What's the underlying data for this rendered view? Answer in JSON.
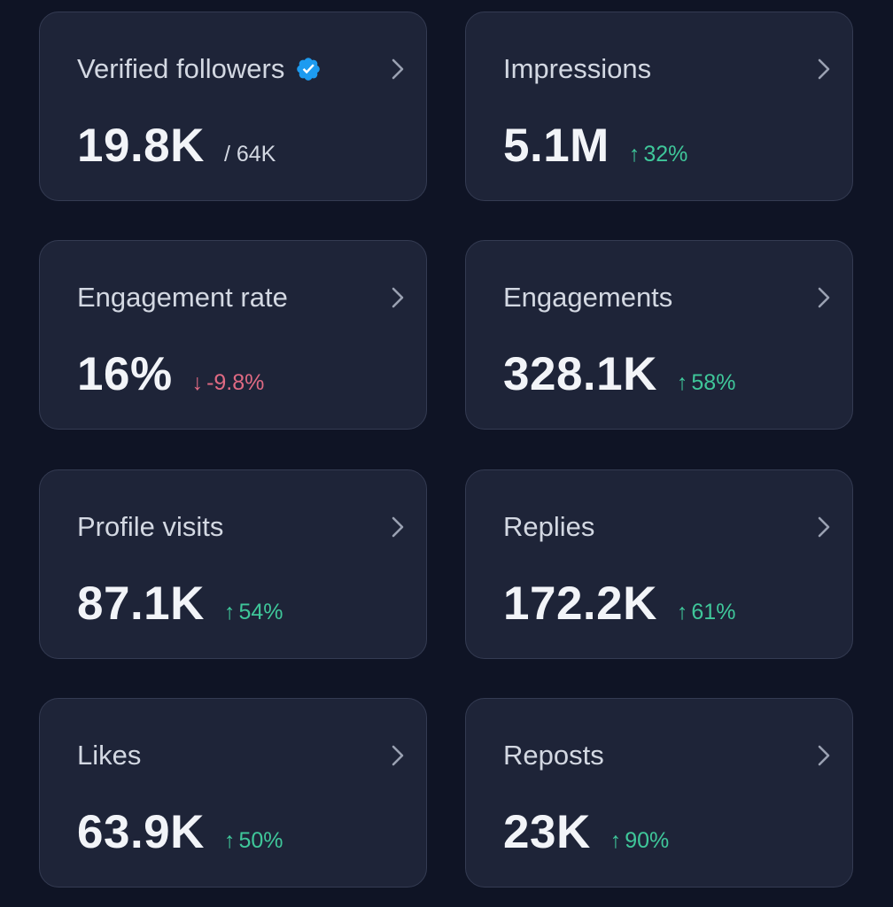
{
  "stats": {
    "verified_followers": {
      "title": "Verified followers",
      "value": "19.8K",
      "total": "/ 64K",
      "badge_icon": "verified-badge-icon",
      "badge_color": "#1d9bf0"
    },
    "impressions": {
      "title": "Impressions",
      "value": "5.1M",
      "arrow": "↑",
      "delta": "32%"
    },
    "engagement_rate": {
      "title": "Engagement rate",
      "value": "16%",
      "arrow": "↓",
      "delta": "-9.8%"
    },
    "engagements": {
      "title": "Engagements",
      "value": "328.1K",
      "arrow": "↑",
      "delta": "58%"
    },
    "profile_visits": {
      "title": "Profile visits",
      "value": "87.1K",
      "arrow": "↑",
      "delta": "54%"
    },
    "replies": {
      "title": "Replies",
      "value": "172.2K",
      "arrow": "↑",
      "delta": "61%"
    },
    "likes": {
      "title": "Likes",
      "value": "63.9K",
      "arrow": "↑",
      "delta": "50%"
    },
    "reposts": {
      "title": "Reposts",
      "value": "23K",
      "arrow": "↑",
      "delta": "90%"
    }
  },
  "colors": {
    "background": "#0f1425",
    "card": "#1e2438",
    "positive": "#3fc79a",
    "negative": "#e06a83"
  },
  "icons": {
    "chevron": "chevron-right-icon",
    "up": "arrow-up-icon",
    "down": "arrow-down-icon"
  }
}
